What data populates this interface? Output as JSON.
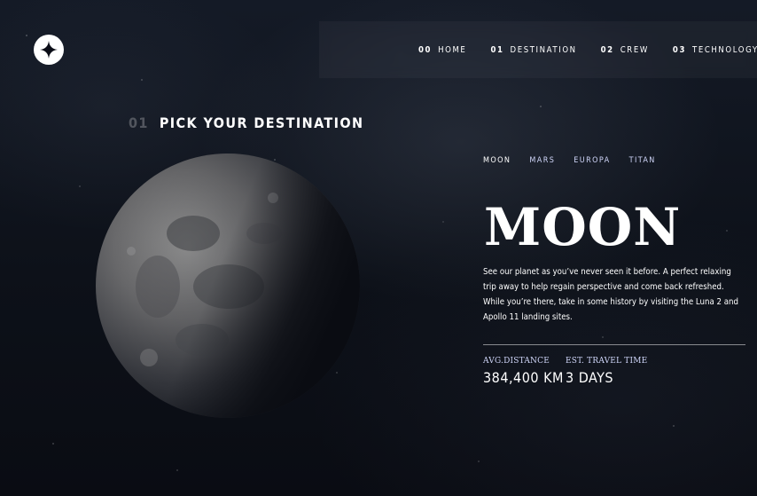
{
  "logo": {
    "icon": "star-icon"
  },
  "nav": {
    "items": [
      {
        "num": "00",
        "label": "HOME"
      },
      {
        "num": "01",
        "label": "DESTINATION"
      },
      {
        "num": "02",
        "label": "CREW"
      },
      {
        "num": "03",
        "label": "TECHNOLOGY"
      }
    ],
    "active_index": 1
  },
  "page": {
    "heading_num": "01",
    "heading_label": "PICK YOUR DESTINATION"
  },
  "destination": {
    "tabs": [
      "MOON",
      "MARS",
      "EUROPA",
      "TITAN"
    ],
    "active_tab": 0,
    "name": "MOON",
    "description": "See our planet as you’ve never seen it before. A perfect relaxing trip away to help regain perspective and come back refreshed. While you’re there, take in some history by visiting the Luna 2 and Apollo 11 landing sites.",
    "distance_label": "AVG.DISTANCE",
    "distance_value": "384,400 KM",
    "travel_label": "EST. TRAVEL TIME",
    "travel_value": "3 DAYS"
  },
  "colors": {
    "background": "#0b0d17",
    "accent_text": "#d0d6f9",
    "white": "#ffffff"
  }
}
